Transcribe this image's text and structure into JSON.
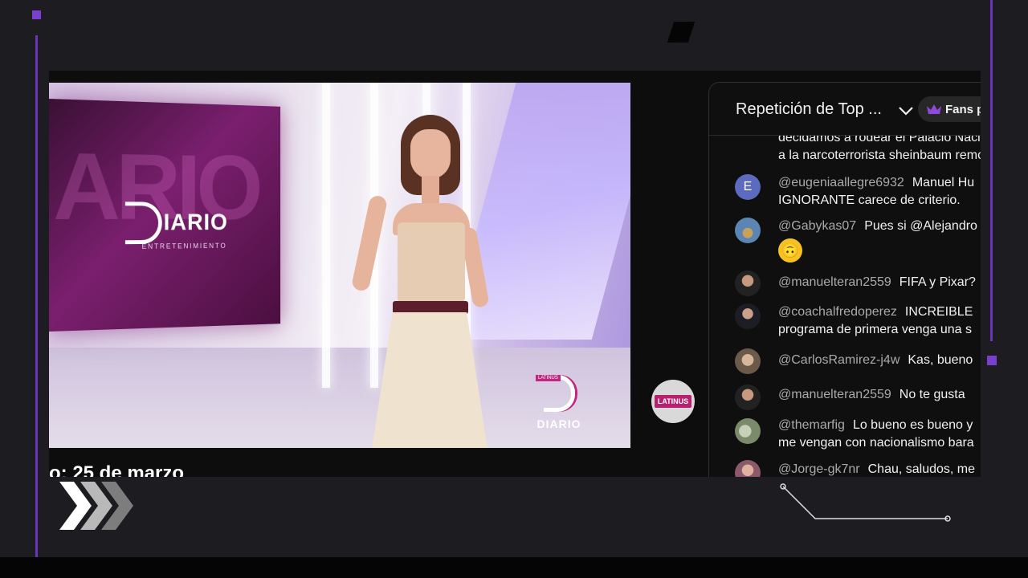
{
  "video": {
    "panel_logo_word": "IARIO",
    "panel_sub": "ENTRETENIMIENTO",
    "panel_bigtext": "ARIO",
    "bug_tag": "LATINUS",
    "bug_word": "DIARIO",
    "badge_label": "LATINUS",
    "date_text": "o: 25 de marzo"
  },
  "chat": {
    "title": "Repetición de Top ...",
    "fans_label": "Fans p",
    "messages": [
      {
        "author": "",
        "text": "decidamos a rodear el Palacio Nacional",
        "text2": "a la narcoterrorista sheinbaum remover",
        "avatar": "none"
      },
      {
        "author": "@eugeniaallegre6932",
        "text": "Manuel Hu",
        "text2": "IGNORANTE carece de criterio.",
        "avatar": "E",
        "avatar_color": "#5c6bc0"
      },
      {
        "author": "@Gabykas07",
        "text": "Pues si @Alejandro",
        "emoji": "🙃",
        "avatar": "photo",
        "avatar_color": "#4b6e8c"
      },
      {
        "author": "@manuelteran2559",
        "text": "FIFA y Pixar?",
        "avatar": "photo",
        "avatar_color": "#3a2d2a"
      },
      {
        "author": "@coachalfredoperez",
        "text": "INCREIBLE",
        "text2": "programa de primera venga una s",
        "avatar": "photo",
        "avatar_color": "#2d2a33"
      },
      {
        "author": "@CarlosRamirez-j4w",
        "text": "Kas, bueno",
        "avatar": "photo",
        "avatar_color": "#6b5a4a"
      },
      {
        "author": "@manuelteran2559",
        "text": "No te gusta",
        "avatar": "photo",
        "avatar_color": "#3a2d2a"
      },
      {
        "author": "@themarfig",
        "text": "Lo bueno es bueno y",
        "text2": "me vengan con nacionalismo bara",
        "avatar": "photo",
        "avatar_color": "#7a8a6a"
      },
      {
        "author": "@Jorge-gk7nr",
        "text": "Chau, saludos, me",
        "avatar": "photo",
        "avatar_color": "#8a5a6a"
      }
    ]
  },
  "colors": {
    "accent_purple": "#6a35b8",
    "background": "#1c1c21",
    "chat_bg": "#0f0f0f",
    "author_gray": "#aaaaaa"
  },
  "icons": [
    "chevron-down-icon",
    "crown-icon",
    "fast-forward-chevrons-icon"
  ]
}
